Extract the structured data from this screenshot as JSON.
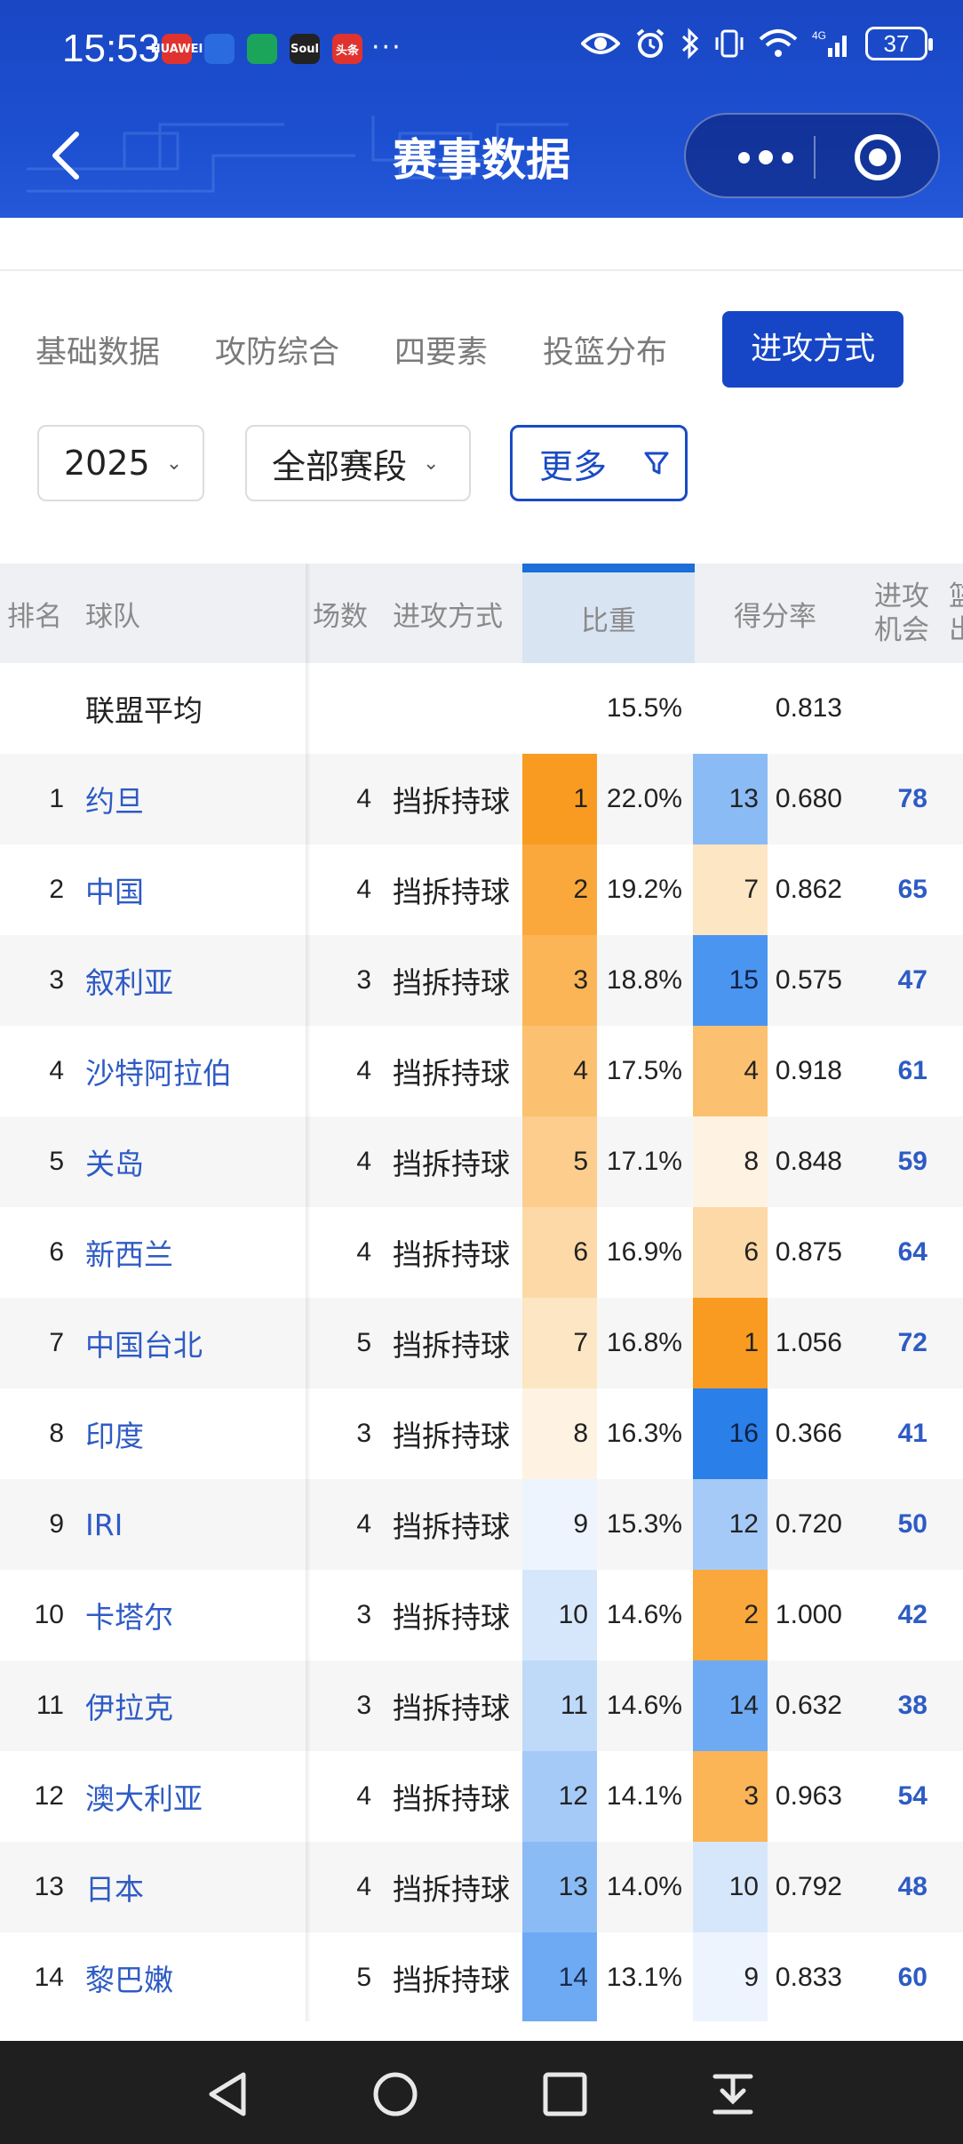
{
  "status_bar": {
    "time": "15:53",
    "notification_icons": [
      {
        "name": "huawei-icon",
        "text": "HUAWEI",
        "color": "#e0332f"
      },
      {
        "name": "app-blue-icon",
        "text": "",
        "color": "#2a6be0"
      },
      {
        "name": "mobile-icon",
        "text": "",
        "color": "#1aa55a"
      },
      {
        "name": "soul-icon",
        "text": "Soul",
        "color": "#222222"
      },
      {
        "name": "toutiao-icon",
        "text": "头条",
        "color": "#e0332f"
      }
    ],
    "more_dots": "···",
    "battery": "37"
  },
  "nav": {
    "title": "赛事数据"
  },
  "tabs": [
    {
      "label": "基础数据",
      "active": false
    },
    {
      "label": "攻防综合",
      "active": false
    },
    {
      "label": "四要素",
      "active": false
    },
    {
      "label": "投篮分布",
      "active": false
    },
    {
      "label": "进攻方式",
      "active": true
    }
  ],
  "filters": {
    "year": "2025",
    "stage": "全部赛段",
    "more": "更多"
  },
  "table": {
    "headers": {
      "rank": "排名",
      "team": "球队",
      "games": "场数",
      "method": "进攻方式",
      "bizhong": "比重",
      "defenlv": "得分率",
      "chances_line1": "进攻",
      "chances_line2": "机会",
      "extra_line1": "篮",
      "extra_line2": "出"
    },
    "league_avg": {
      "label": "联盟平均",
      "bizhong": "15.5%",
      "defenlv": "0.813"
    },
    "rows": [
      {
        "rank": "1",
        "team": "约旦",
        "games": "4",
        "method": "挡拆持球",
        "bz_rank": "1",
        "bz": "22.0%",
        "df_rank": "13",
        "df": "0.680",
        "opp": "78"
      },
      {
        "rank": "2",
        "team": "中国",
        "games": "4",
        "method": "挡拆持球",
        "bz_rank": "2",
        "bz": "19.2%",
        "df_rank": "7",
        "df": "0.862",
        "opp": "65"
      },
      {
        "rank": "3",
        "team": "叙利亚",
        "games": "3",
        "method": "挡拆持球",
        "bz_rank": "3",
        "bz": "18.8%",
        "df_rank": "15",
        "df": "0.575",
        "opp": "47"
      },
      {
        "rank": "4",
        "team": "沙特阿拉伯",
        "games": "4",
        "method": "挡拆持球",
        "bz_rank": "4",
        "bz": "17.5%",
        "df_rank": "4",
        "df": "0.918",
        "opp": "61"
      },
      {
        "rank": "5",
        "team": "关岛",
        "games": "4",
        "method": "挡拆持球",
        "bz_rank": "5",
        "bz": "17.1%",
        "df_rank": "8",
        "df": "0.848",
        "opp": "59"
      },
      {
        "rank": "6",
        "team": "新西兰",
        "games": "4",
        "method": "挡拆持球",
        "bz_rank": "6",
        "bz": "16.9%",
        "df_rank": "6",
        "df": "0.875",
        "opp": "64"
      },
      {
        "rank": "7",
        "team": "中国台北",
        "games": "5",
        "method": "挡拆持球",
        "bz_rank": "7",
        "bz": "16.8%",
        "df_rank": "1",
        "df": "1.056",
        "opp": "72"
      },
      {
        "rank": "8",
        "team": "印度",
        "games": "3",
        "method": "挡拆持球",
        "bz_rank": "8",
        "bz": "16.3%",
        "df_rank": "16",
        "df": "0.366",
        "opp": "41"
      },
      {
        "rank": "9",
        "team": "IRI",
        "games": "4",
        "method": "挡拆持球",
        "bz_rank": "9",
        "bz": "15.3%",
        "df_rank": "12",
        "df": "0.720",
        "opp": "50"
      },
      {
        "rank": "10",
        "team": "卡塔尔",
        "games": "3",
        "method": "挡拆持球",
        "bz_rank": "10",
        "bz": "14.6%",
        "df_rank": "2",
        "df": "1.000",
        "opp": "42"
      },
      {
        "rank": "11",
        "team": "伊拉克",
        "games": "3",
        "method": "挡拆持球",
        "bz_rank": "11",
        "bz": "14.6%",
        "df_rank": "14",
        "df": "0.632",
        "opp": "38"
      },
      {
        "rank": "12",
        "team": "澳大利亚",
        "games": "4",
        "method": "挡拆持球",
        "bz_rank": "12",
        "bz": "14.1%",
        "df_rank": "3",
        "df": "0.963",
        "opp": "54"
      },
      {
        "rank": "13",
        "team": "日本",
        "games": "4",
        "method": "挡拆持球",
        "bz_rank": "13",
        "bz": "14.0%",
        "df_rank": "10",
        "df": "0.792",
        "opp": "48"
      },
      {
        "rank": "14",
        "team": "黎巴嫩",
        "games": "5",
        "method": "挡拆持球",
        "bz_rank": "14",
        "bz": "13.1%",
        "df_rank": "9",
        "df": "0.833",
        "opp": "60"
      }
    ]
  },
  "colors": {
    "rank_scale": [
      "#f99b20",
      "#faa83b",
      "#fbb556",
      "#fbc170",
      "#fccd8c",
      "#fdd9a8",
      "#fde6c4",
      "#fef3e2",
      "#eef4fd",
      "#d7e7fb",
      "#bfd9f9",
      "#a5caf7",
      "#8bbbf5",
      "#6eaaf3",
      "#4a95f0",
      "#2a7fe8"
    ],
    "accent": "#1646c6",
    "link": "#2e5bc4"
  }
}
